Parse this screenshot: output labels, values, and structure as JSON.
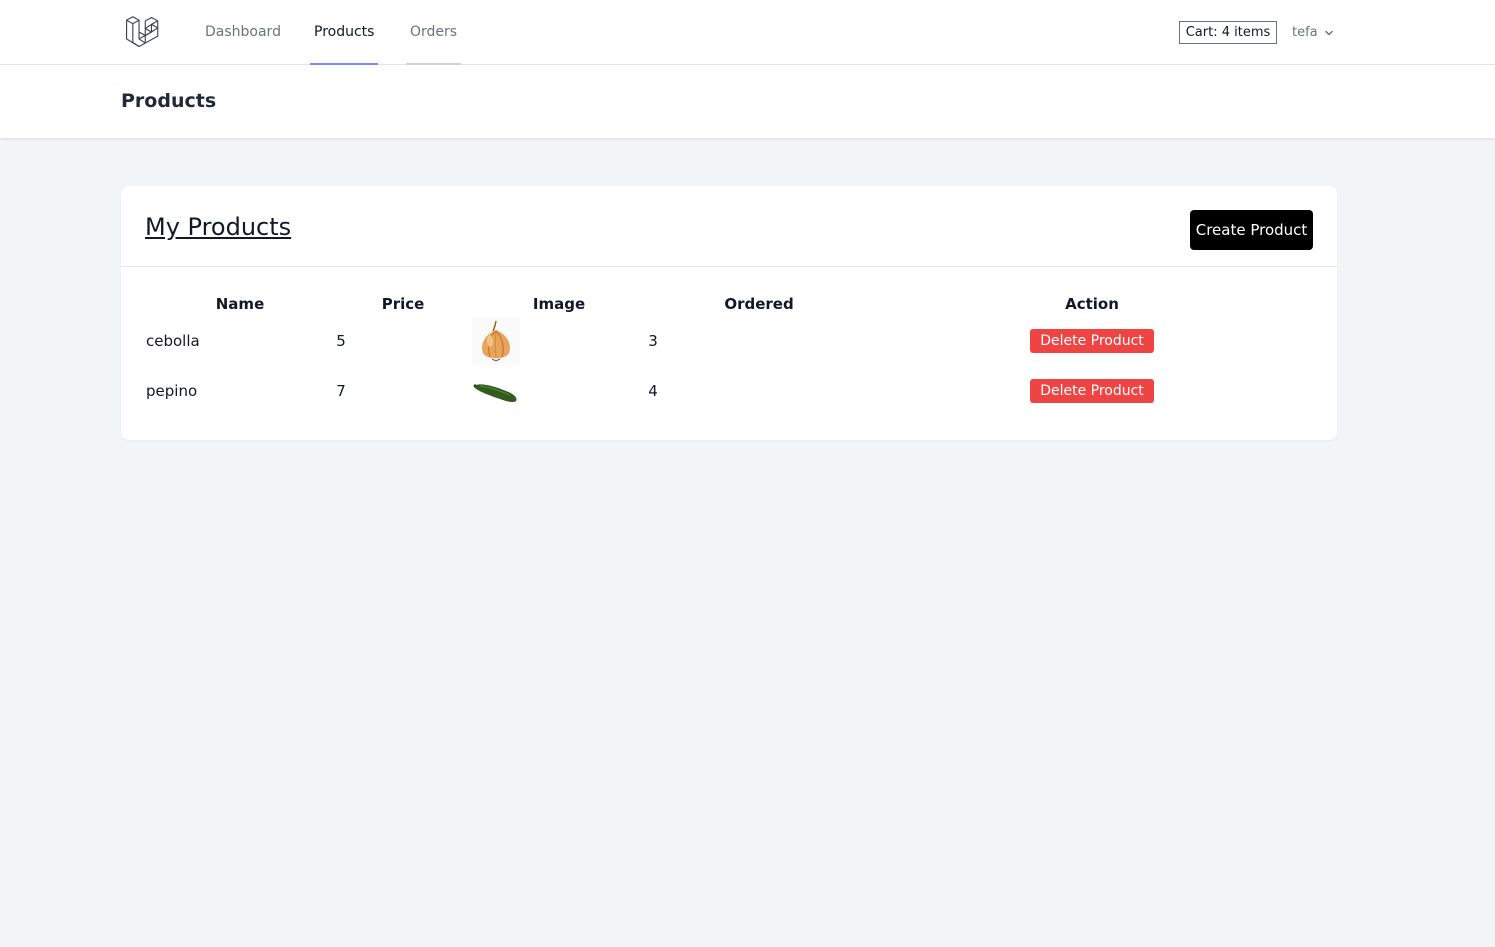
{
  "nav": {
    "logo": "laravel-logo",
    "links": [
      {
        "label": "Dashboard",
        "active": false
      },
      {
        "label": "Products",
        "active": true
      },
      {
        "label": "Orders",
        "active": false
      }
    ],
    "cart_label": "Cart: 4 items",
    "user_name": "tefa"
  },
  "header": {
    "title": "Products"
  },
  "main": {
    "card_title": "My Products",
    "create_button": "Create Product",
    "columns": [
      "Name",
      "Price",
      "Image",
      "Ordered",
      "Action"
    ],
    "rows": [
      {
        "name": "cebolla",
        "price": "5",
        "image": "onion-image",
        "ordered": "3",
        "action": "Delete Product"
      },
      {
        "name": "pepino",
        "price": "7",
        "image": "cucumber-image",
        "ordered": "4",
        "action": "Delete Product"
      }
    ]
  },
  "colors": {
    "nav_active_underline": "#818cf8",
    "delete_button": "#ef4444",
    "create_button": "#000000",
    "page_background": "#f3f4f6"
  }
}
